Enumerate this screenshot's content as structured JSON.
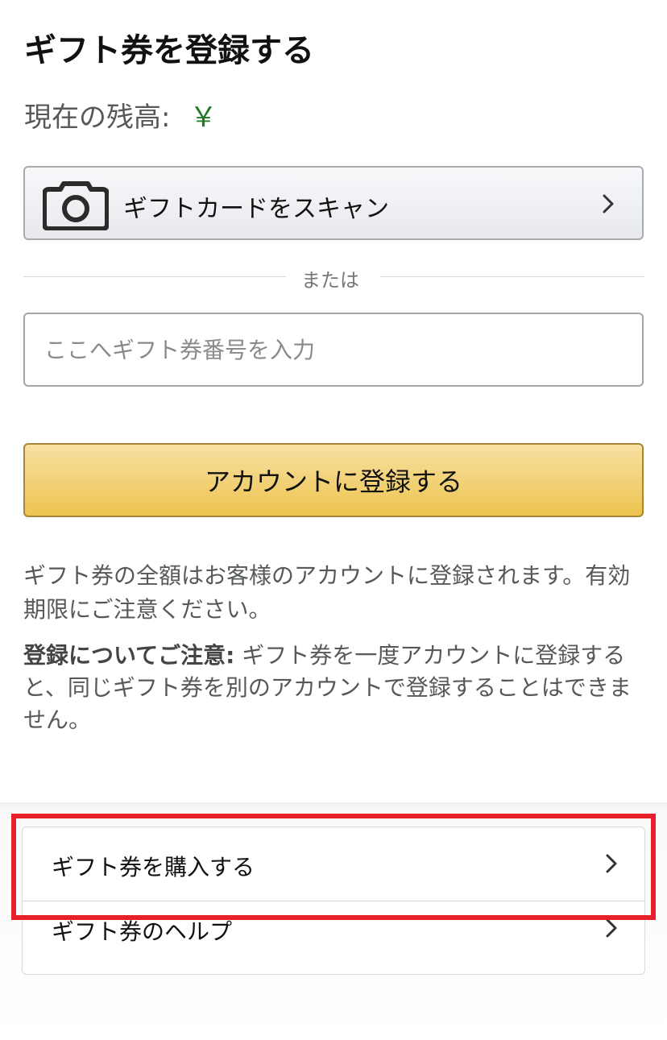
{
  "page": {
    "title": "ギフト券を登録する"
  },
  "balance": {
    "label": "現在の残高:",
    "value": "￥"
  },
  "scan_button": {
    "label": "ギフトカードをスキャン",
    "icon": "camera-icon"
  },
  "divider": {
    "text": "または"
  },
  "code_input": {
    "placeholder": "ここへギフト券番号を入力",
    "value": ""
  },
  "register_button": {
    "label": "アカウントに登録する"
  },
  "info": {
    "text": "ギフト券の全額はお客様のアカウントに登録されます。有効期限にご注意ください。"
  },
  "note": {
    "strong": "登録についてご注意:",
    "text": " ギフト券を一度アカウントに登録すると、同じギフト券を別のアカウントで登録することはできません。"
  },
  "links": [
    {
      "label": "ギフト券を購入する",
      "icon": "chevron-right-icon"
    },
    {
      "label": "ギフト券のヘルプ",
      "icon": "chevron-right-icon"
    }
  ],
  "colors": {
    "balance_value": "#1f7a1f",
    "register_button": "#eec44f",
    "highlight": "#e8202a"
  }
}
